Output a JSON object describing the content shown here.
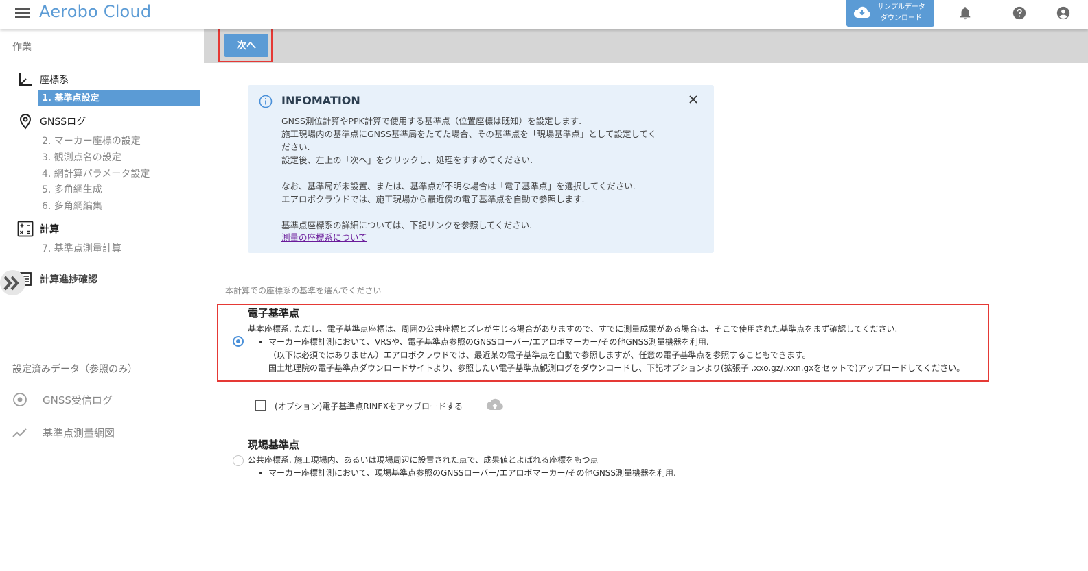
{
  "app": {
    "title": "Aerobo Cloud",
    "accent_color": "#5b9bd5",
    "sample_download_label": "サンプルデータ\nダウンロード"
  },
  "header_icons": [
    "menu-icon",
    "cloud-download-icon",
    "bell-icon",
    "help-icon",
    "account-icon"
  ],
  "sidebar": {
    "work_heading": "作業",
    "coord_section": "座標系",
    "active_item": "1. 基準点設定",
    "gnss_section": "GNSSログ",
    "gnss_items": [
      "2. マーカー座標の設定",
      "3. 観測点名の設定",
      "4. 網計算パラメータ設定",
      "5. 多角網生成",
      "6. 多角網編集"
    ],
    "calc_section": "計算",
    "calc_items": [
      "7. 基準点測量計算"
    ],
    "progress_section": "計算進捗確認",
    "ref_heading": "設定済みデータ（参照のみ）",
    "ref_items": [
      "GNSS受信ログ",
      "基準点測量網図"
    ]
  },
  "toolbar": {
    "next_label": "次へ"
  },
  "info": {
    "title": "INFOMATION",
    "lines": [
      "GNSS測位計算やPPK計算で使用する基準点（位置座標は既知）を設定します.",
      "施工現場内の基準点にGNSS基準局をたてた場合、その基準点を「現場基準点」として設定してく",
      "ださい.",
      "設定後、左上の「次へ」をクリックし、処理をすすめてください.",
      "",
      "なお、基準局が未設置、または、基準点が不明な場合は「電子基準点」を選択してください.",
      "エアロボクラウドでは、施工現場から最近傍の電子基準点を自動で参照します.",
      "",
      "基準点座標系の詳細については、下記リンクを参照してください."
    ],
    "link": "測量の座標系について"
  },
  "selection": {
    "label": "本計算での座標系の基準を選んでください",
    "option1": {
      "title": "電子基準点",
      "desc": "基本座標系. ただし、電子基準点座標は、周囲の公共座標とズレが生じる場合がありますので、すでに測量成果がある場合は、そこで使用された基準点をまず確認してください.",
      "bullet": "マーカー座標計測において、VRSや、電子基準点参照のGNSSローバー/エアロボマーカー/その他GNSS測量機器を利用.",
      "note1": "（以下は必須ではありません）エアロボクラウドでは、最近某の電子基準点を自動で参照しますが、任意の電子基準点を参照することもできます。",
      "note2": "国土地理院の電子基準点ダウンロードサイトより、参照したい電子基準点観測ログをダウンロードし、下記オプションより(拡張子 .xxo.gz/.xxn.gxをセットで)アップロードしてください。",
      "selected": true
    },
    "checkbox_label": "(オプション)電子基準点RINEXをアップロードする",
    "option2": {
      "title": "現場基準点",
      "desc": "公共座標系. 施工現場内、あるいは現場周辺に設置された点で、成果値とよばれる座標をもつ点",
      "bullet": "マーカー座標計測において、現場基準点参照のGNSSローバー/エアロボマーカー/その他GNSS測量機器を利用.",
      "selected": false
    }
  }
}
